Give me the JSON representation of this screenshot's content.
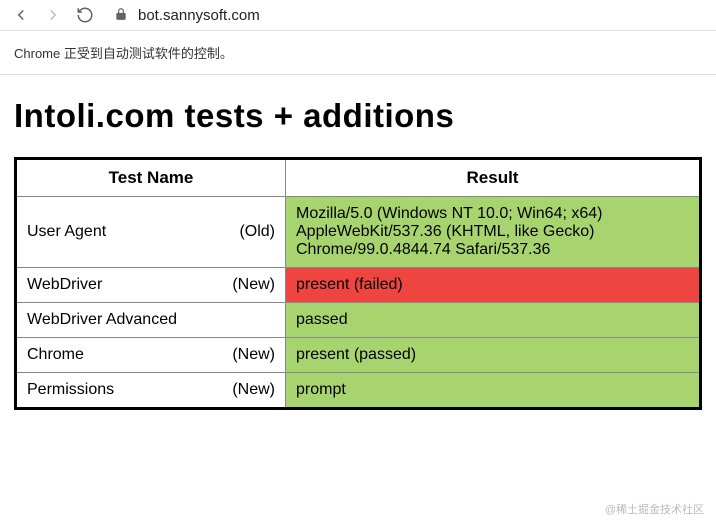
{
  "browser": {
    "url": "bot.sannysoft.com",
    "back_icon": "back-arrow",
    "forward_icon": "forward-arrow",
    "reload_icon": "reload",
    "lock_icon": "lock"
  },
  "info_bar": "Chrome 正受到自动测试软件的控制。",
  "page": {
    "heading": "Intoli.com tests + additions",
    "table_headers": {
      "name": "Test Name",
      "result": "Result"
    },
    "rows": [
      {
        "name": "User Agent",
        "tag": "(Old)",
        "result": "Mozilla/5.0 (Windows NT 10.0; Win64; x64) AppleWebKit/537.36 (KHTML, like Gecko) Chrome/99.0.4844.74 Safari/537.36",
        "status": "pass"
      },
      {
        "name": "WebDriver",
        "tag": "(New)",
        "result": "present (failed)",
        "status": "fail"
      },
      {
        "name": "WebDriver Advanced",
        "tag": "",
        "result": "passed",
        "status": "pass"
      },
      {
        "name": "Chrome",
        "tag": "(New)",
        "result": "present (passed)",
        "status": "pass"
      },
      {
        "name": "Permissions",
        "tag": "(New)",
        "result": "prompt",
        "status": "pass"
      }
    ]
  },
  "watermark": "@稀土掘金技术社区"
}
